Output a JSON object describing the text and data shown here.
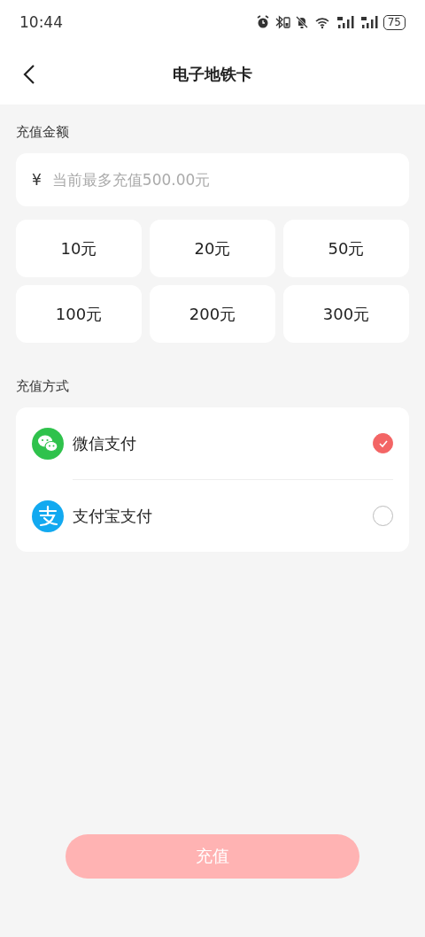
{
  "status_bar": {
    "time": "10:44",
    "battery": "75"
  },
  "header": {
    "title": "电子地铁卡"
  },
  "amount_section": {
    "label": "充值金额",
    "currency": "¥",
    "placeholder": "当前最多充值500.00元"
  },
  "amount_options": [
    {
      "label": "10元",
      "selected": false
    },
    {
      "label": "20元",
      "selected": false
    },
    {
      "label": "50元",
      "selected": false
    },
    {
      "label": "100元",
      "selected": false
    },
    {
      "label": "200元",
      "selected": false
    },
    {
      "label": "300元",
      "selected": false
    }
  ],
  "payment_section": {
    "label": "充值方式"
  },
  "payment_methods": [
    {
      "kind": "wechat",
      "label": "微信支付",
      "selected": true
    },
    {
      "kind": "alipay",
      "label": "支付宝支付",
      "selected": false
    }
  ],
  "submit_button": {
    "label": "充值",
    "disabled": true
  }
}
